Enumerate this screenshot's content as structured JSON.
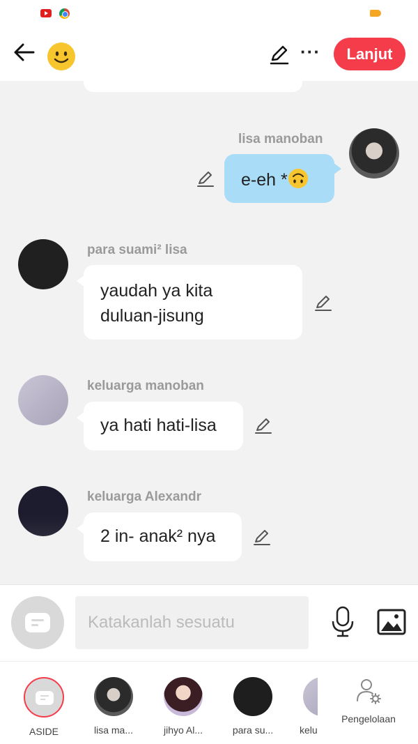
{
  "statusbar": {
    "icons": [
      "youtube-icon",
      "chrome-icon",
      "battery-icon"
    ]
  },
  "header": {
    "back_icon": "arrow-left-icon",
    "emoji_icon": "smiley-icon",
    "edit_icon": "pencil-icon",
    "more_icon": "more-horizontal-icon",
    "more_glyph": "···",
    "next_label": "Lanjut"
  },
  "chat": {
    "messages": [
      {
        "sender": "lisa manoban",
        "text": "e-eh *",
        "emoji": "upside-down-face",
        "mine": true
      },
      {
        "sender": "para suami² lisa",
        "text_lines": [
          "yaudah ya kita",
          "duluan-jisung"
        ]
      },
      {
        "sender": "keluarga manoban",
        "text": "ya hati hati-lisa"
      },
      {
        "sender": "keluarga Alexandr",
        "text": "2 in- anak² nya"
      }
    ]
  },
  "composer": {
    "placeholder": "Katakanlah sesuatu",
    "mic_icon": "microphone-icon",
    "image_icon": "image-icon"
  },
  "tray": {
    "items": [
      {
        "label": "ASIDE",
        "selected": true
      },
      {
        "label": "lisa ma..."
      },
      {
        "label": "jihyo Al..."
      },
      {
        "label": "para su..."
      },
      {
        "label": "kelu"
      }
    ],
    "manage_label": "Pengelolaan"
  },
  "colors": {
    "accent": "#f53c4a",
    "my_bubble": "#a9dcf7",
    "background": "#f2f2f2"
  }
}
